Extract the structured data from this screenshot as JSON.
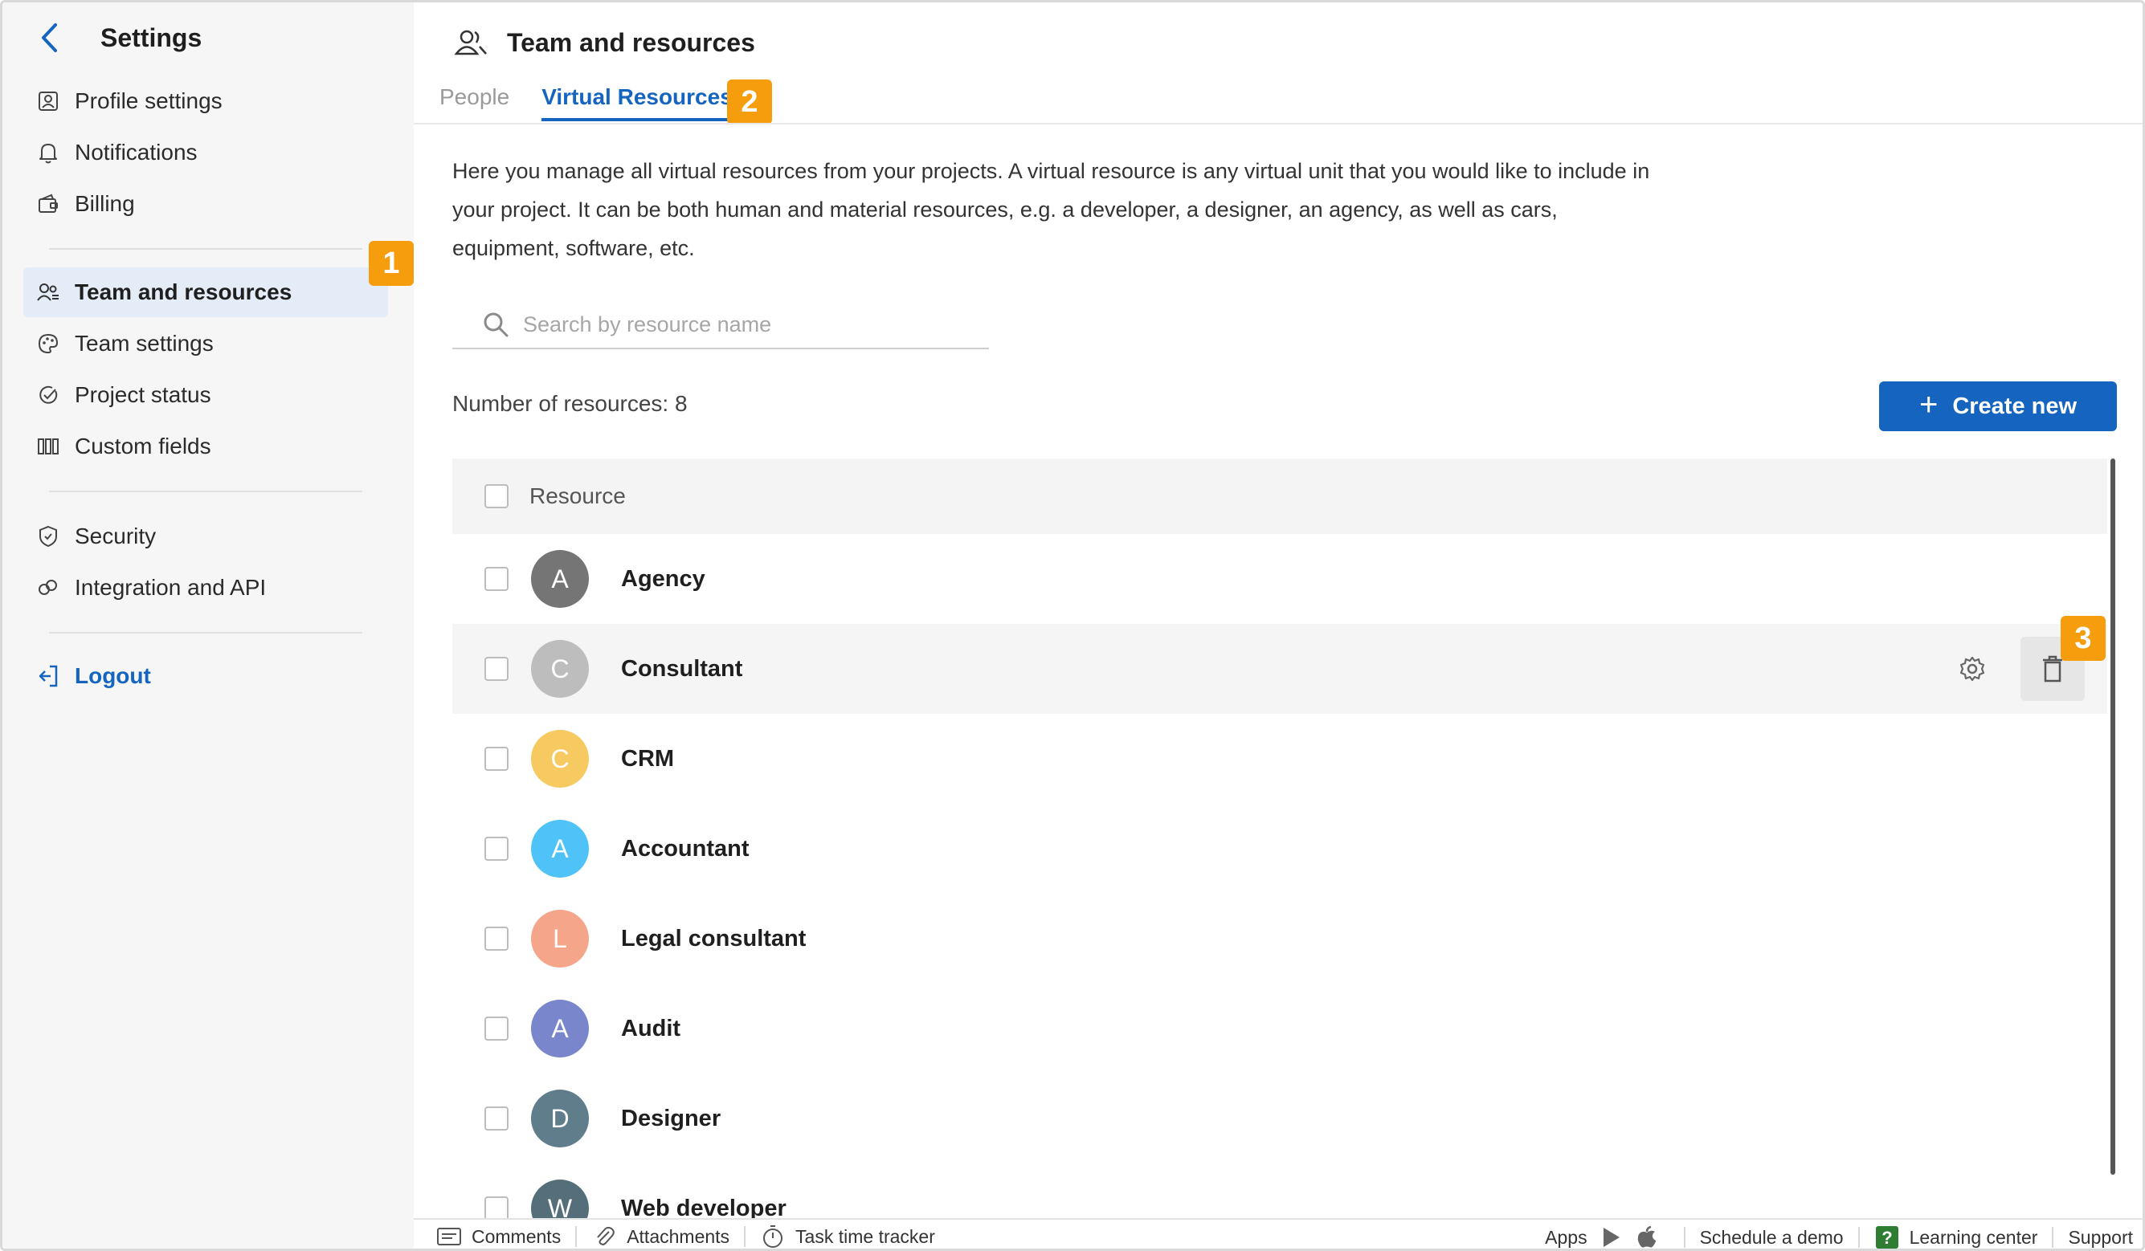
{
  "sidebar": {
    "title": "Settings",
    "items": [
      {
        "label": "Profile settings",
        "icon": "profile-icon"
      },
      {
        "label": "Notifications",
        "icon": "bell-icon"
      },
      {
        "label": "Billing",
        "icon": "wallet-icon"
      },
      {
        "label": "Team and resources",
        "icon": "team-icon",
        "active": true
      },
      {
        "label": "Team settings",
        "icon": "palette-icon"
      },
      {
        "label": "Project status",
        "icon": "status-icon"
      },
      {
        "label": "Custom fields",
        "icon": "columns-icon"
      },
      {
        "label": "Security",
        "icon": "shield-icon"
      },
      {
        "label": "Integration and API",
        "icon": "integration-icon"
      }
    ],
    "logout": "Logout"
  },
  "badges": [
    "1",
    "2",
    "3"
  ],
  "page": {
    "title": "Team and resources",
    "tabs": [
      {
        "label": "People",
        "active": false
      },
      {
        "label": "Virtual Resources",
        "active": true
      }
    ],
    "description": "Here you manage all virtual resources from your projects. A virtual resource is any virtual unit that you would like to include in your project. It can be both human and material resources, e.g. a developer, a designer, an agency, as well as cars, equipment, software, etc.",
    "search_placeholder": "Search by resource name",
    "count_text": "Number of resources: 8",
    "create_label": "Create new"
  },
  "table": {
    "header": "Resource",
    "rows": [
      {
        "initial": "A",
        "name": "Agency",
        "color": "#757575"
      },
      {
        "initial": "C",
        "name": "Consultant",
        "color": "#bdbdbd"
      },
      {
        "initial": "C",
        "name": "CRM",
        "color": "#f7ca61"
      },
      {
        "initial": "A",
        "name": "Accountant",
        "color": "#4fc3f7"
      },
      {
        "initial": "L",
        "name": "Legal consultant",
        "color": "#f4a58a"
      },
      {
        "initial": "A",
        "name": "Audit",
        "color": "#7986cb"
      },
      {
        "initial": "D",
        "name": "Designer",
        "color": "#607d8b"
      },
      {
        "initial": "W",
        "name": "Web developer",
        "color": "#546e7a"
      }
    ]
  },
  "footer": {
    "comments": "Comments",
    "attachments": "Attachments",
    "tracker": "Task time tracker",
    "apps": "Apps",
    "demo": "Schedule a demo",
    "learning": "Learning center",
    "support": "Support"
  },
  "colors": {
    "accent": "#1565c0",
    "badge": "#f59d0c"
  }
}
